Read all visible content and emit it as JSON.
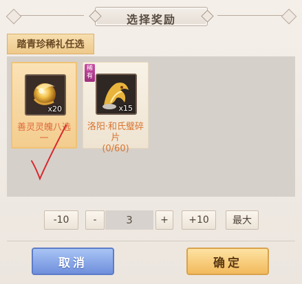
{
  "dialog": {
    "title": "选择奖励"
  },
  "category": {
    "label": "踏青珍稀礼任选"
  },
  "rewards": [
    {
      "name": "善灵灵魄八选一",
      "quantity": "x20",
      "selected": true,
      "icon": "golden-orb-icon"
    },
    {
      "name": "洛阳·和氏璧碎片",
      "progress": "(0/60)",
      "quantity": "x15",
      "rare_badge": "稀有",
      "icon": "golden-dragon-icon"
    }
  ],
  "quantity_controls": {
    "minus_ten": "-10",
    "minus_one": "-",
    "value": "3",
    "plus_one": "+",
    "plus_ten": "+10",
    "max": "最大"
  },
  "actions": {
    "cancel": "取消",
    "confirm": "确定"
  },
  "colors": {
    "accent_orange": "#e06a3b",
    "cancel_blue": "#6f8fdc",
    "confirm_gold": "#f2b95c",
    "annotation_red": "#d8282e"
  }
}
